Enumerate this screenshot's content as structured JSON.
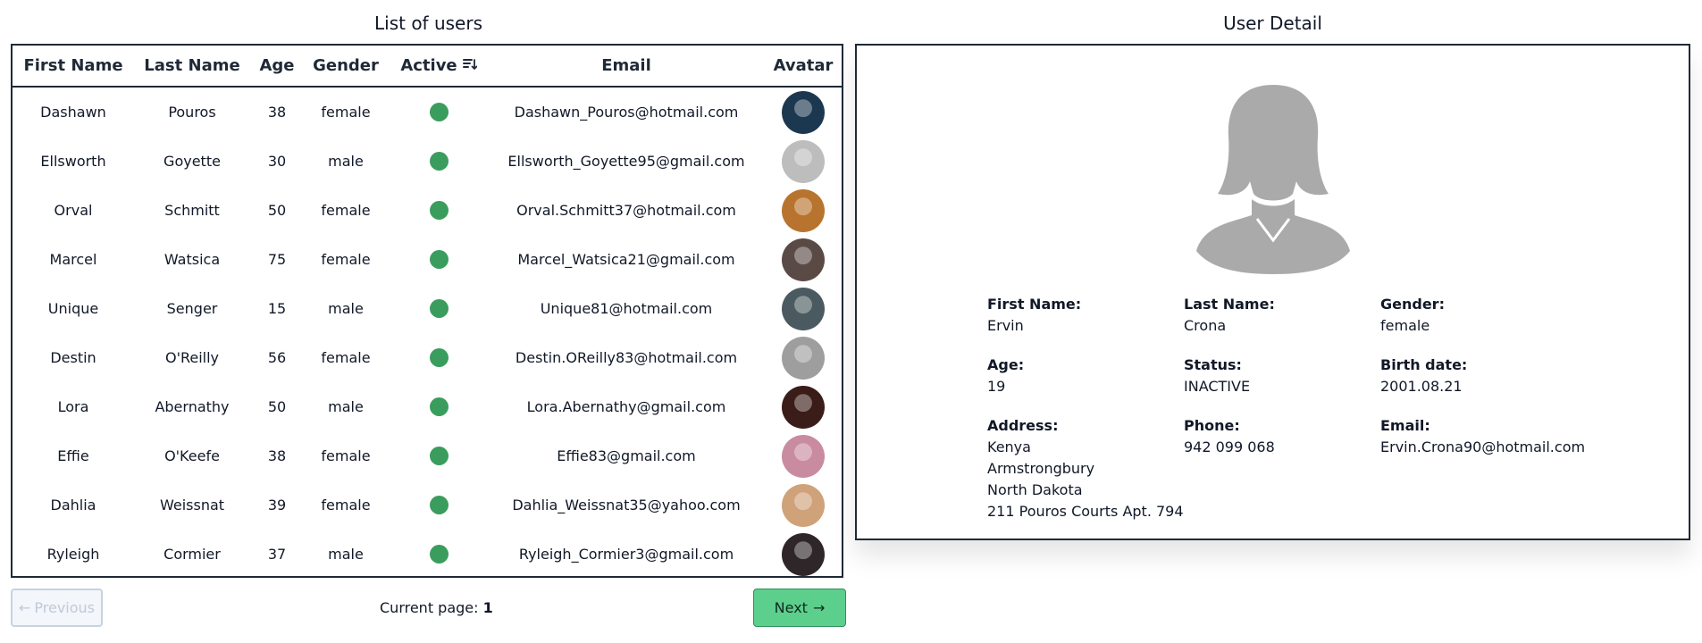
{
  "left_title": "List of users",
  "right_title": "User Detail",
  "table": {
    "headers": [
      "First Name",
      "Last Name",
      "Age",
      "Gender",
      "Active",
      "Email",
      "Avatar"
    ],
    "rows": [
      {
        "first": "Dashawn",
        "last": "Pouros",
        "age": "38",
        "gender": "female",
        "active": true,
        "email": "Dashawn_Pouros@hotmail.com",
        "avatar_color": "#1c3850"
      },
      {
        "first": "Ellsworth",
        "last": "Goyette",
        "age": "30",
        "gender": "male",
        "active": true,
        "email": "Ellsworth_Goyette95@gmail.com",
        "avatar_color": "#bdbdbd"
      },
      {
        "first": "Orval",
        "last": "Schmitt",
        "age": "50",
        "gender": "female",
        "active": true,
        "email": "Orval.Schmitt37@hotmail.com",
        "avatar_color": "#b8742e"
      },
      {
        "first": "Marcel",
        "last": "Watsica",
        "age": "75",
        "gender": "female",
        "active": true,
        "email": "Marcel_Watsica21@gmail.com",
        "avatar_color": "#5a4a45"
      },
      {
        "first": "Unique",
        "last": "Senger",
        "age": "15",
        "gender": "male",
        "active": true,
        "email": "Unique81@hotmail.com",
        "avatar_color": "#4a5a60"
      },
      {
        "first": "Destin",
        "last": "O'Reilly",
        "age": "56",
        "gender": "female",
        "active": true,
        "email": "Destin.OReilly83@hotmail.com",
        "avatar_color": "#9e9e9e"
      },
      {
        "first": "Lora",
        "last": "Abernathy",
        "age": "50",
        "gender": "male",
        "active": true,
        "email": "Lora.Abernathy@gmail.com",
        "avatar_color": "#3a1c18"
      },
      {
        "first": "Effie",
        "last": "O'Keefe",
        "age": "38",
        "gender": "female",
        "active": true,
        "email": "Effie83@gmail.com",
        "avatar_color": "#c98ba0"
      },
      {
        "first": "Dahlia",
        "last": "Weissnat",
        "age": "39",
        "gender": "female",
        "active": true,
        "email": "Dahlia_Weissnat35@yahoo.com",
        "avatar_color": "#cfa27a"
      },
      {
        "first": "Ryleigh",
        "last": "Cormier",
        "age": "37",
        "gender": "male",
        "active": true,
        "email": "Ryleigh_Cormier3@gmail.com",
        "avatar_color": "#2e2628"
      }
    ],
    "active_color": "#3a9d5d"
  },
  "pagination": {
    "prev_label": "Previous",
    "current_label": "Current page:",
    "current_page": "1",
    "next_label": "Next"
  },
  "detail": {
    "first_name_label": "First Name:",
    "first_name": "Ervin",
    "last_name_label": "Last Name:",
    "last_name": "Crona",
    "gender_label": "Gender:",
    "gender": "female",
    "age_label": "Age:",
    "age": "19",
    "status_label": "Status:",
    "status": "INACTIVE",
    "birth_label": "Birth date:",
    "birth": "2001.08.21",
    "address_label": "Address:",
    "address_lines": [
      "Kenya",
      "Armstrongbury",
      "North Dakota",
      "211 Pouros Courts Apt. 794"
    ],
    "phone_label": "Phone:",
    "phone": "942 099 068",
    "email_label": "Email:",
    "email": "Ervin.Crona90@hotmail.com",
    "silhouette_icon": "female-user-silhouette-icon",
    "silhouette_color": "#aaaaaa"
  }
}
